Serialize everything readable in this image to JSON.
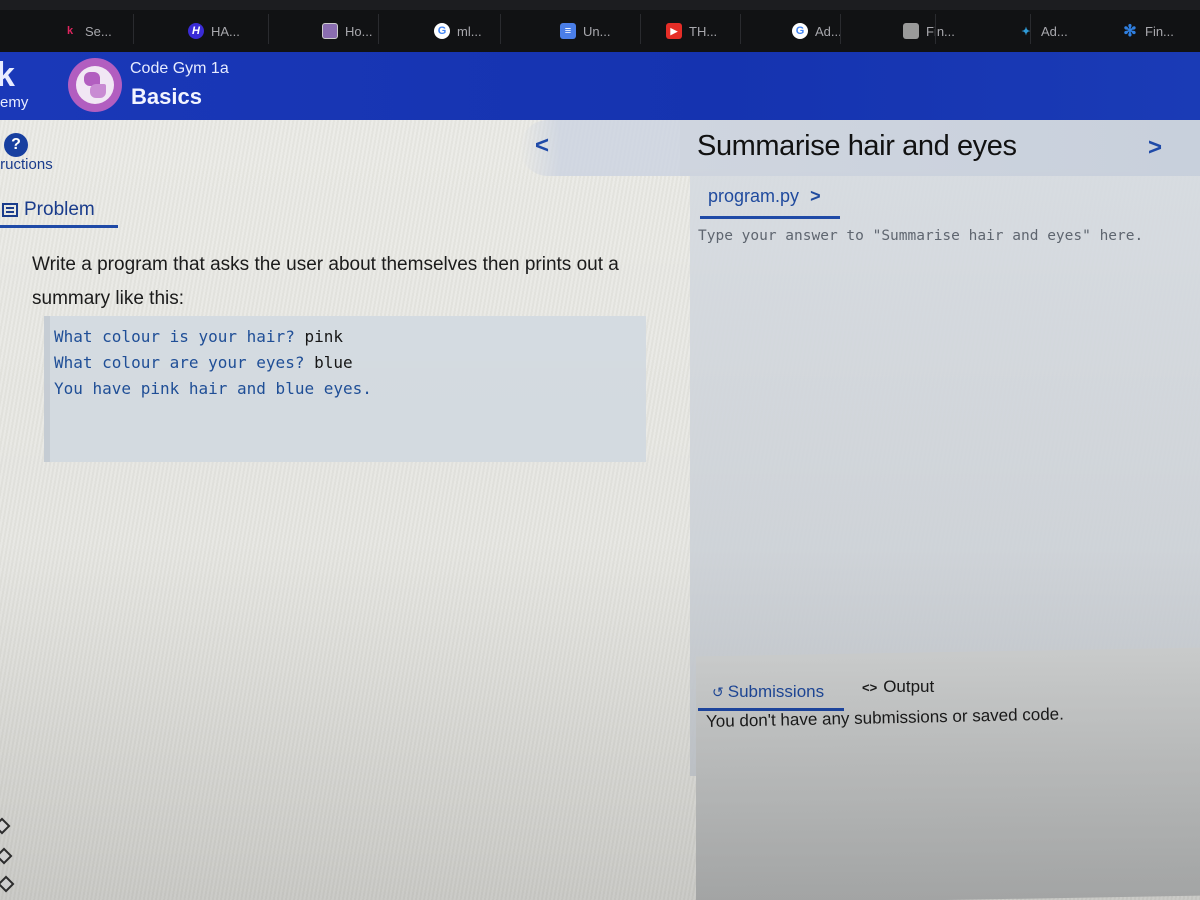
{
  "browser": {
    "bookmarks": [
      {
        "label": "Se...",
        "icon": "kodekademy-icon",
        "color": "#e0245e"
      },
      {
        "label": "HA...",
        "icon": "h-logo-icon",
        "color": "#3a2bd6"
      },
      {
        "label": "Ho...",
        "icon": "image-thumbnail-icon",
        "color": "#8a6db0"
      },
      {
        "label": "ml...",
        "icon": "google-icon",
        "color": "#4285f4"
      },
      {
        "label": "Un...",
        "icon": "google-docs-icon",
        "color": "#4a7ee8"
      },
      {
        "label": "TH...",
        "icon": "youtube-icon",
        "color": "#e52d27"
      },
      {
        "label": "Ad...",
        "icon": "google-icon",
        "color": "#4285f4"
      },
      {
        "label": "Fin...",
        "icon": "image-thumbnail-icon",
        "color": "#9a9a9a"
      },
      {
        "label": "Ad...",
        "icon": "sparkle-icon",
        "color": "#2f9ad6"
      },
      {
        "label": "Fin...",
        "icon": "asterisk-icon",
        "color": "#2f7fe0"
      }
    ]
  },
  "header": {
    "logo_letter": "k",
    "logo_subtext": "emy",
    "course_subtitle": "Code Gym 1a",
    "course_title": "Basics",
    "accent_color": "#1a38b8"
  },
  "sidebar": {
    "help_glyph": "?",
    "instructions_label": "tructions",
    "problem_tab_label": "Problem"
  },
  "navigation": {
    "prev_glyph": "<",
    "next_glyph": ">",
    "task_title": "Summarise hair and eyes"
  },
  "problem": {
    "description": "Write a program that asks the user about themselves then prints out a summary like this:",
    "example": [
      {
        "prompt": "What colour is your hair? ",
        "input": "pink"
      },
      {
        "prompt": "What colour are your eyes? ",
        "input": "blue"
      },
      {
        "prompt": "You have pink hair and blue eyes.",
        "input": ""
      }
    ]
  },
  "editor": {
    "file_tab_label": "program.py",
    "file_tab_chevron": ">",
    "placeholder": "Type your answer to \"Summarise hair and eyes\" here."
  },
  "results": {
    "submissions_tab_label": "Submissions",
    "output_tab_label": "Output",
    "output_tab_glyph": "<>",
    "empty_message": "You don't have any submissions or saved code."
  }
}
